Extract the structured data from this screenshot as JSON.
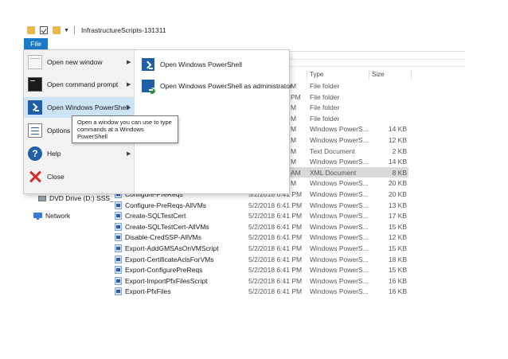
{
  "window": {
    "title": "InfrastructureScripts-131311"
  },
  "file_menu": {
    "tab_label": "File",
    "items": [
      {
        "label": "Open new window",
        "icon": "new-window-icon",
        "has_submenu": true
      },
      {
        "label": "Open command prompt",
        "icon": "command-prompt-icon",
        "has_submenu": true
      },
      {
        "label": "Open Windows PowerShell",
        "icon": "powershell-icon",
        "has_submenu": true,
        "active": true
      },
      {
        "label": "Options",
        "icon": "options-icon",
        "has_submenu": false
      },
      {
        "label": "Help",
        "icon": "help-icon",
        "has_submenu": true
      },
      {
        "label": "Close",
        "icon": "close-icon",
        "has_submenu": false
      }
    ],
    "submenu": [
      {
        "label": "Open Windows PowerShell",
        "icon": "powershell-icon"
      },
      {
        "label": "Open Windows PowerShell as administrator",
        "icon": "powershell-admin-icon"
      }
    ],
    "tooltip": "Open a window you can use to type commands at a Windows PowerShell"
  },
  "columns": {
    "type": "Type",
    "size": "Size"
  },
  "navigation": {
    "dvd_drive": "DVD Drive (D:) SSS_",
    "network": "Network"
  },
  "files": [
    {
      "name": "",
      "date": "M",
      "type": "File folder",
      "size": ""
    },
    {
      "name": "",
      "date": "PM",
      "type": "File folder",
      "size": ""
    },
    {
      "name": "",
      "date": "M",
      "type": "File folder",
      "size": ""
    },
    {
      "name": "",
      "date": "M",
      "type": "File folder",
      "size": ""
    },
    {
      "name": "",
      "date": "M",
      "type": "Windows PowerS...",
      "size": "14 KB"
    },
    {
      "name": "",
      "date": "M",
      "type": "Windows PowerS...",
      "size": "12 KB"
    },
    {
      "name": "",
      "date": "M",
      "type": "Text Document",
      "size": "2 KB"
    },
    {
      "name": "",
      "date": "M",
      "type": "Windows PowerS...",
      "size": "14 KB"
    },
    {
      "name": "",
      "date": "AM",
      "type": "XML Document",
      "size": "8 KB",
      "selected": true
    },
    {
      "name": "",
      "date": "M",
      "type": "Windows PowerS...",
      "size": "20 KB"
    },
    {
      "name": "Configure-PreReqs",
      "date": "5/2/2018 6:41 PM",
      "type": "Windows PowerS...",
      "size": "20 KB"
    },
    {
      "name": "Configure-PreReqs-AllVMs",
      "date": "5/2/2018 6:41 PM",
      "type": "Windows PowerS...",
      "size": "13 KB"
    },
    {
      "name": "Create-SQLTestCert",
      "date": "5/2/2018 6:41 PM",
      "type": "Windows PowerS...",
      "size": "17 KB"
    },
    {
      "name": "Create-SQLTestCert-AllVMs",
      "date": "5/2/2018 6:41 PM",
      "type": "Windows PowerS...",
      "size": "15 KB"
    },
    {
      "name": "Disable-CredSSP-AllVMs",
      "date": "5/2/2018 6:41 PM",
      "type": "Windows PowerS...",
      "size": "12 KB"
    },
    {
      "name": "Export-AddGMSAsOnVMScript",
      "date": "5/2/2018 6:41 PM",
      "type": "Windows PowerS...",
      "size": "15 KB"
    },
    {
      "name": "Export-CertificateAclsForVMs",
      "date": "5/2/2018 6:41 PM",
      "type": "Windows PowerS...",
      "size": "18 KB"
    },
    {
      "name": "Export-ConfigurePreReqs",
      "date": "5/2/2018 6:41 PM",
      "type": "Windows PowerS...",
      "size": "15 KB"
    },
    {
      "name": "Export-ImportPfxFilesScript",
      "date": "5/2/2018 6:41 PM",
      "type": "Windows PowerS...",
      "size": "16 KB"
    },
    {
      "name": "Export-PfxFiles",
      "date": "5/2/2018 6:41 PM",
      "type": "Windows PowerS...",
      "size": "16 KB"
    }
  ]
}
